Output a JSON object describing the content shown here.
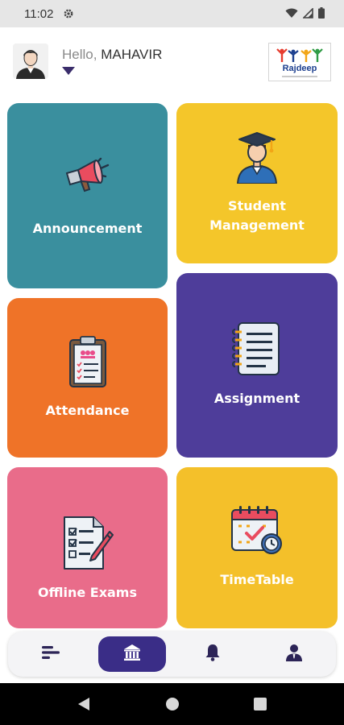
{
  "status_bar": {
    "time": "11:02",
    "icons": [
      "settings-gear-icon",
      "wifi-icon",
      "signal-icon",
      "battery-icon"
    ]
  },
  "header": {
    "greeting_prefix": "Hello, ",
    "user_name": "MAHAVIR",
    "avatar_icon": "user-avatar-icon",
    "dropdown_icon": "caret-down-icon",
    "brand_name": "Rajdeep"
  },
  "tiles": [
    {
      "label": "Announcement",
      "icon": "megaphone-icon",
      "color": "#3a8f9e"
    },
    {
      "label": "Student\nManagement",
      "icon": "graduate-icon",
      "color": "#f4c62a"
    },
    {
      "label": "Attendance",
      "icon": "clipboard-icon",
      "color": "#ef7328"
    },
    {
      "label": "Assignment",
      "icon": "notebook-icon",
      "color": "#4e3d9a"
    },
    {
      "label": "Offline Exams",
      "icon": "exam-checklist-icon",
      "color": "#e96c8a"
    },
    {
      "label": "TimeTable",
      "icon": "calendar-icon",
      "color": "#f4c02a"
    }
  ],
  "bottom_nav": {
    "items": [
      {
        "icon": "menu-lines-icon",
        "active": false
      },
      {
        "icon": "institution-icon",
        "active": true
      },
      {
        "icon": "bell-icon",
        "active": false
      },
      {
        "icon": "profile-icon",
        "active": false
      }
    ],
    "active_color": "#3a2d87"
  },
  "system_nav": {
    "icons": [
      "back-icon",
      "home-circle-icon",
      "recents-square-icon"
    ]
  }
}
